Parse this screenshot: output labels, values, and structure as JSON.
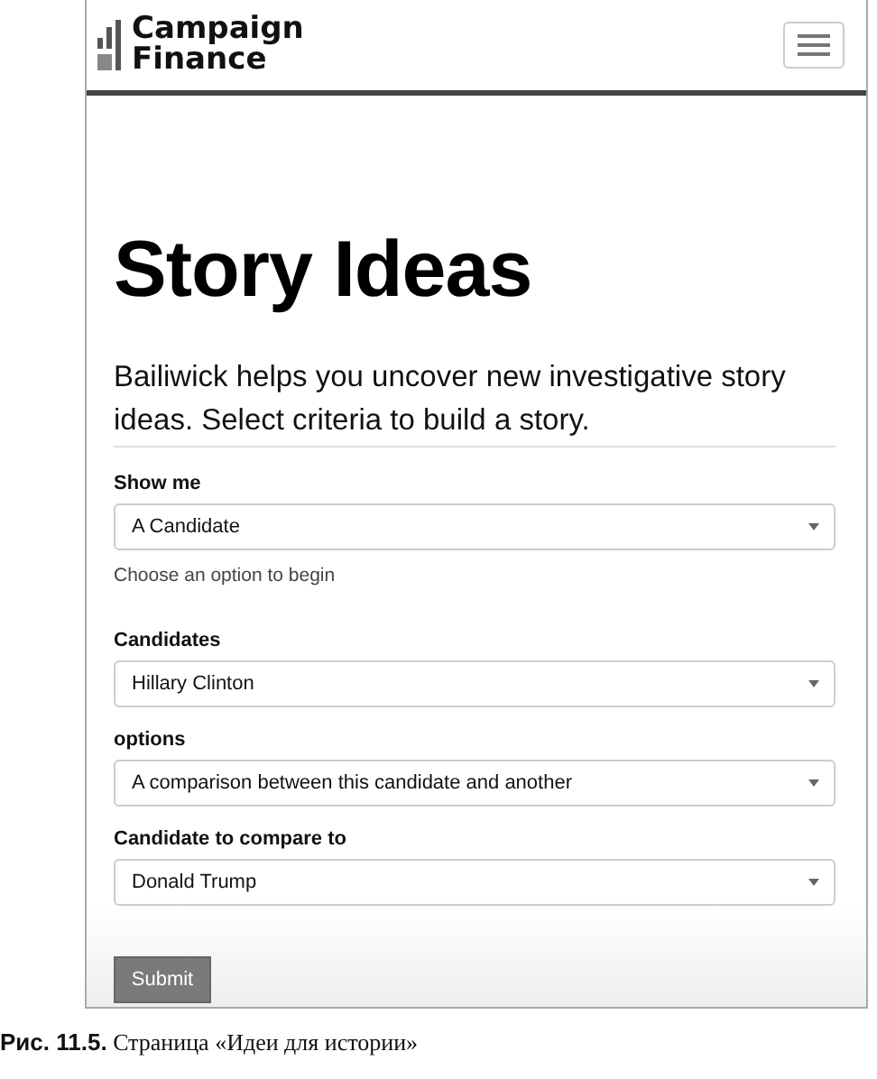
{
  "brand": {
    "line_1": "Campaign",
    "line_2": "Finance"
  },
  "heading": "Story Ideas",
  "intro": "Bailiwick helps you uncover new investigative story ideas. Select criteria to build a story.",
  "fields": [
    {
      "label": "Show me",
      "value": "A Candidate",
      "hint": "Choose an option to begin"
    },
    {
      "label": "Candidates",
      "value": "Hillary Clinton"
    },
    {
      "label": "options",
      "value": "A comparison between this candidate and another"
    },
    {
      "label": "Candidate to compare to",
      "value": "Donald Trump"
    }
  ],
  "submit": "Submit",
  "caption": {
    "number": "Рис. 11.5.",
    "text": "Страница «Идеи для истории»"
  }
}
